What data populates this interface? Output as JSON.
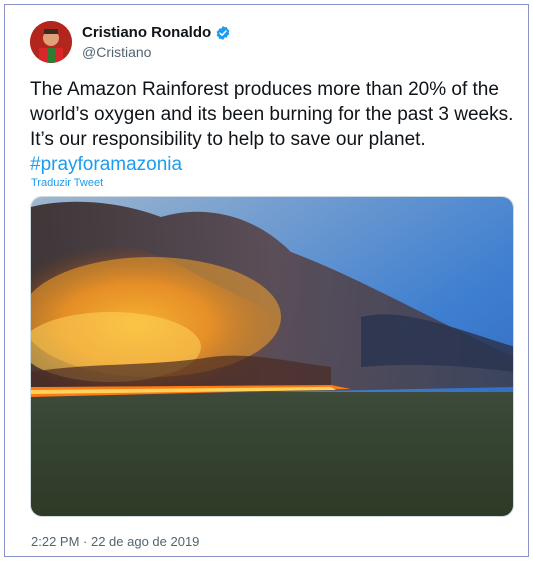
{
  "tweet": {
    "author_name": "Cristiano Ronaldo",
    "author_handle": "@Cristiano",
    "text": "The Amazon Rainforest produces more than 20% of the world’s oxygen and its been burning for the past 3 weeks. It’s our responsibility to help to save our planet.",
    "hashtag": "#prayforamazonia",
    "translate_label": "Traduzir Tweet",
    "timestamp": "2:22 PM · 22 de ago de 2019"
  },
  "colors": {
    "link": "#1d9bf0",
    "secondary_text": "#536471",
    "verified": "#1d9bf0",
    "frame_border": "#8a93c9"
  },
  "icons": {
    "verified": "verified-badge-icon"
  }
}
